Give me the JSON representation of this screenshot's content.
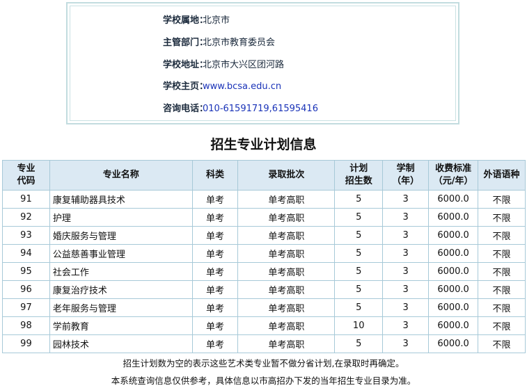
{
  "school_info": {
    "rows": [
      {
        "label": "学校属地：",
        "value": "北京市",
        "link": false
      },
      {
        "label": "主管部门：",
        "value": "北京市教育委员会",
        "link": false
      },
      {
        "label": "学校地址：",
        "value": "北京市大兴区团河路",
        "link": false
      },
      {
        "label": "学校主页：",
        "value": "www.bcsa.edu.cn",
        "link": true
      },
      {
        "label": "咨询电话：",
        "value": "010-61591719,61595416",
        "link": true
      }
    ]
  },
  "section_title": "招生专业计划信息",
  "table": {
    "headers": [
      "专业\n代码",
      "专业名称",
      "科类",
      "录取批次",
      "计划\n招生数",
      "学制\n（年）",
      "收费标准\n（元/年）",
      "外语语种"
    ],
    "rows": [
      [
        "91",
        "康复辅助器具技术",
        "单考",
        "单考高职",
        "5",
        "3",
        "6000.0",
        "不限"
      ],
      [
        "92",
        "护理",
        "单考",
        "单考高职",
        "5",
        "3",
        "6000.0",
        "不限"
      ],
      [
        "93",
        "婚庆服务与管理",
        "单考",
        "单考高职",
        "5",
        "3",
        "6000.0",
        "不限"
      ],
      [
        "94",
        "公益慈善事业管理",
        "单考",
        "单考高职",
        "5",
        "3",
        "6000.0",
        "不限"
      ],
      [
        "95",
        "社会工作",
        "单考",
        "单考高职",
        "5",
        "3",
        "6000.0",
        "不限"
      ],
      [
        "96",
        "康复治疗技术",
        "单考",
        "单考高职",
        "5",
        "3",
        "6000.0",
        "不限"
      ],
      [
        "97",
        "老年服务与管理",
        "单考",
        "单考高职",
        "5",
        "3",
        "6000.0",
        "不限"
      ],
      [
        "98",
        "学前教育",
        "单考",
        "单考高职",
        "10",
        "3",
        "6000.0",
        "不限"
      ],
      [
        "99",
        "园林技术",
        "单考",
        "单考高职",
        "5",
        "3",
        "6000.0",
        "不限"
      ]
    ]
  },
  "notes": [
    "招生计划数为空的表示这些艺术类专业暂不做分省计划,在录取时再确定。",
    "本系统查询信息仅供参考，具体信息以市高招办下发的当年招生专业目录为准。"
  ]
}
